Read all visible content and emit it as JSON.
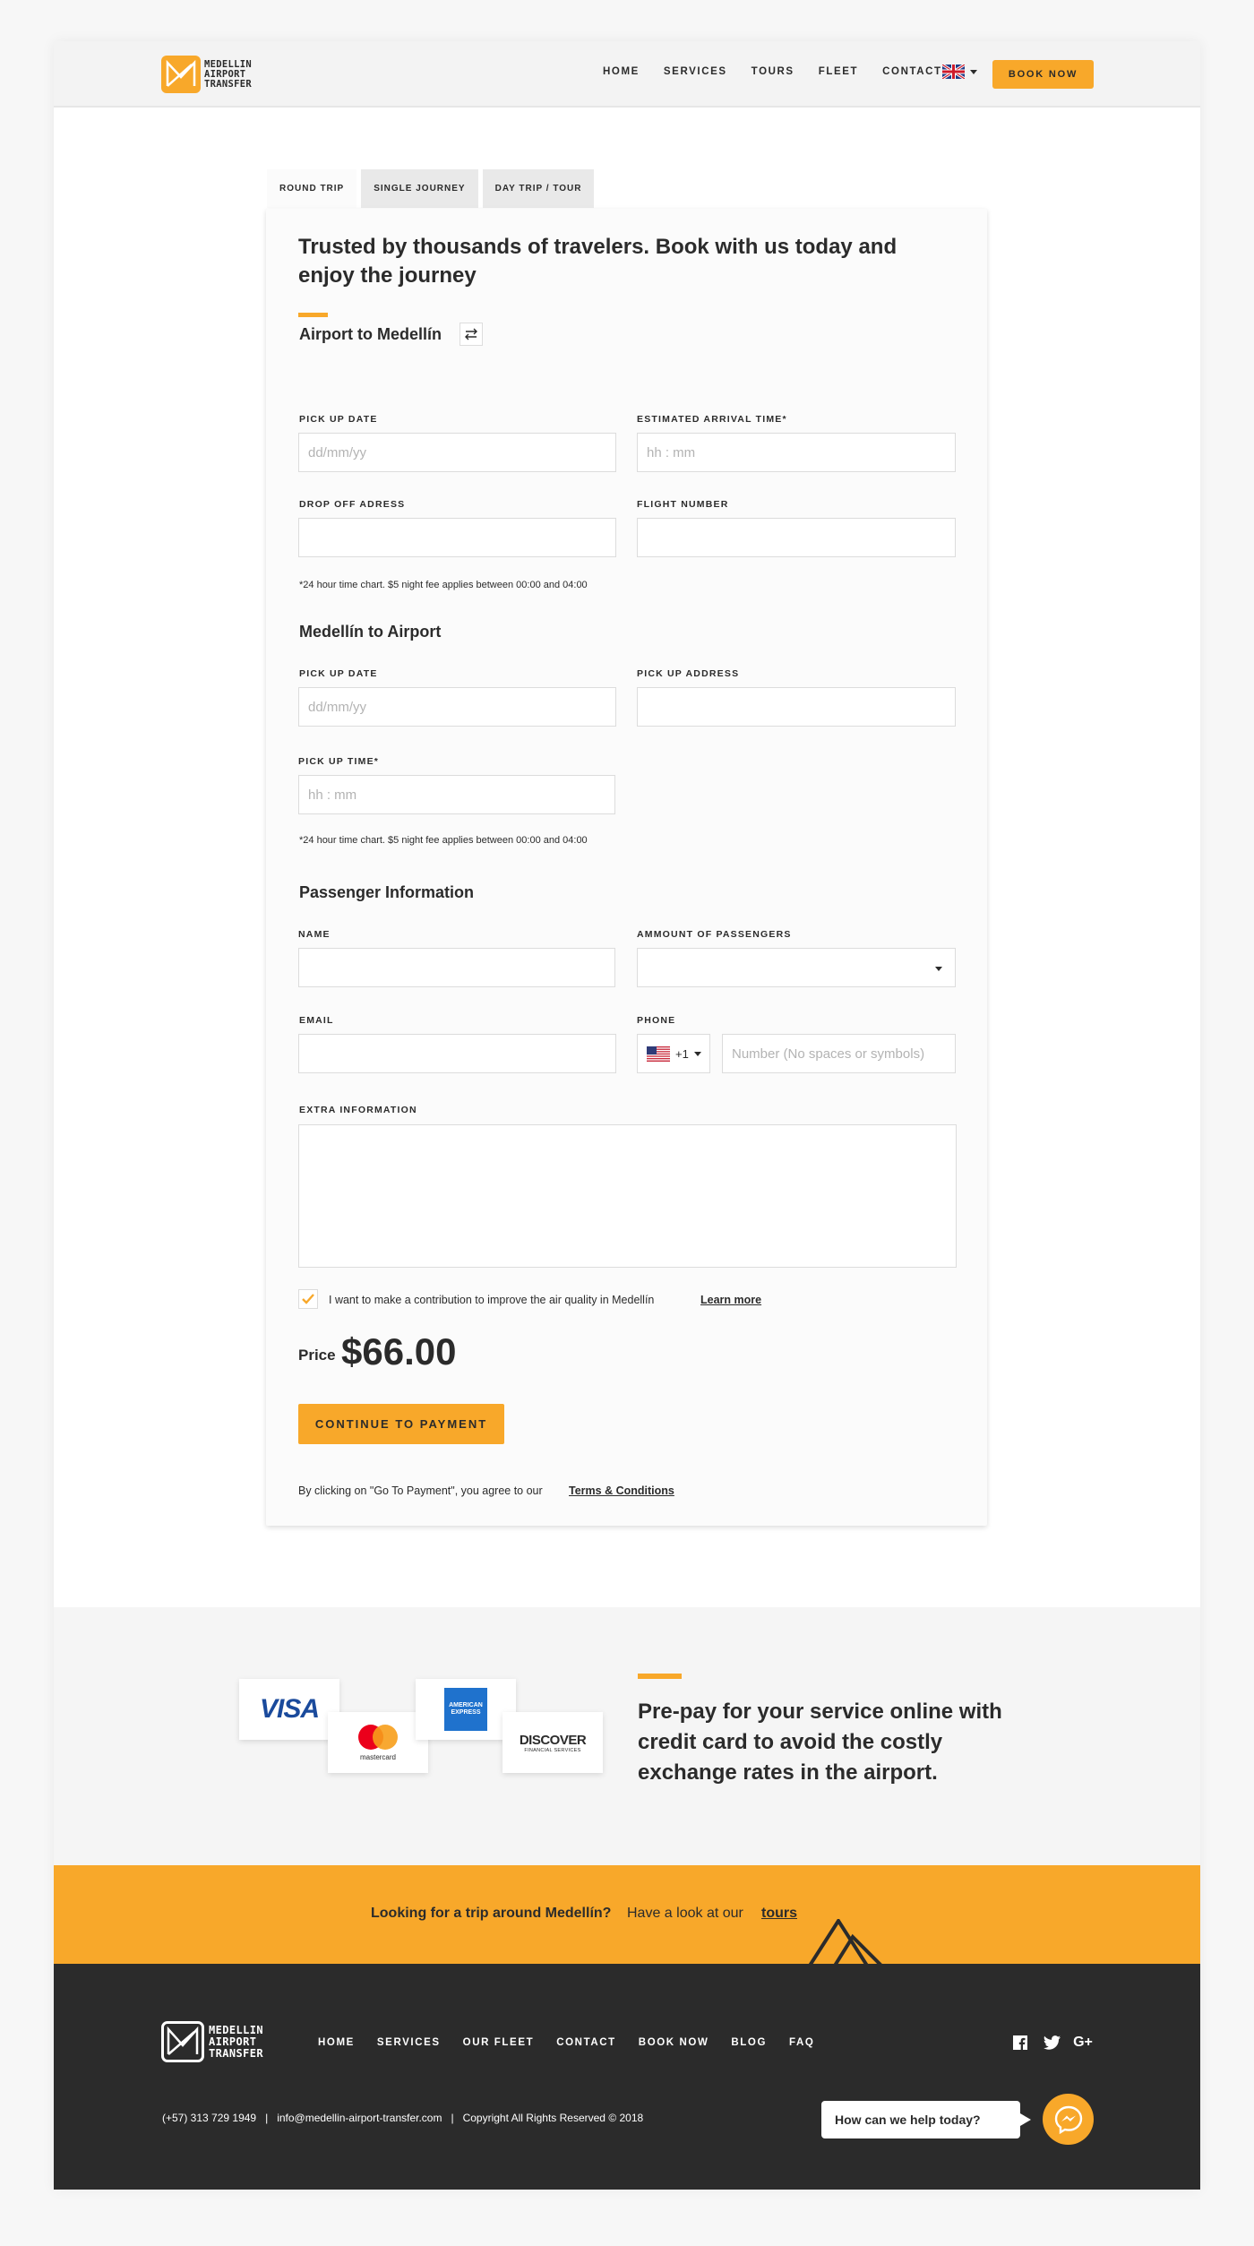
{
  "header": {
    "logo_text": [
      "MEDELLIN",
      "AIRPORT",
      "TRANSFER"
    ],
    "nav": [
      "HOME",
      "SERVICES",
      "TOURS",
      "FLEET",
      "CONTACT"
    ],
    "language_flag": "uk-flag-icon",
    "book_now": "BOOK NOW"
  },
  "tabs": [
    "ROUND TRIP",
    "SINGLE JOURNEY",
    "DAY TRIP / TOUR"
  ],
  "form": {
    "title": "Trusted by thousands of travelers. Book with us today and enjoy the journey",
    "airport_to_medellin": {
      "title": "Airport to Medellín",
      "pickup_date_label": "PICK UP DATE",
      "pickup_date_placeholder": "dd/mm/yy",
      "arrival_time_label": "ESTIMATED ARRIVAL TIME*",
      "arrival_time_placeholder": "hh : mm",
      "dropoff_label": "DROP OFF ADRESS",
      "flight_label": "FLIGHT NUMBER",
      "note": "*24 hour time chart. $5 night fee applies between 00:00 and 04:00"
    },
    "medellin_to_airport": {
      "title": "Medellín to Airport",
      "pickup_date_label": "PICK UP DATE",
      "pickup_date_placeholder": "dd/mm/yy",
      "pickup_address_label": "PICK UP ADDRESS",
      "pickup_time_label": "PICK UP TIME*",
      "pickup_time_placeholder": "hh : mm",
      "note": "*24 hour time chart. $5 night fee applies between 00:00 and 04:00"
    },
    "passenger": {
      "title": "Passenger Information",
      "name_label": "NAME",
      "amount_label": "AMMOUNT OF PASSENGERS",
      "email_label": "EMAIL",
      "phone_label": "PHONE",
      "phone_code": "+1",
      "phone_placeholder": "Number (No spaces or symbols)",
      "extra_label": "EXTRA INFORMATION"
    },
    "contribution_text": "I want to make a contribution to improve the air quality in Medellín",
    "contribution_link": "Learn more",
    "contribution_checked": true,
    "price_label": "Price",
    "price_value": "$66.00",
    "continue_button": "CONTINUE TO PAYMENT",
    "terms_text": "By clicking on \"Go To Payment\", you agree to our",
    "terms_link": "Terms & Conditions"
  },
  "payment": {
    "cards": [
      "VISA",
      "mastercard",
      "AMERICAN EXPRESS",
      "DISCOVER"
    ],
    "discover_sub": "FINANCIAL SERVICES",
    "text": "Pre-pay for your service online with credit card to avoid the costly exchange rates in the airport."
  },
  "tours_banner": {
    "question": "Looking for a trip around Medellín?",
    "text": "Have a look at our",
    "link": "tours"
  },
  "footer": {
    "logo_text": [
      "MEDELLIN",
      "AIRPORT",
      "TRANSFER"
    ],
    "nav": [
      "HOME",
      "SERVICES",
      "OUR FLEET",
      "CONTACT",
      "BOOK NOW",
      "BLOG",
      "FAQ"
    ],
    "info": "(+57) 313 729 1949   |   info@medellin-airport-transfer.com   |   Copyright All Rights Reserved © 2018",
    "chat_text": "How can we help today?",
    "social_icons": [
      "facebook-icon",
      "twitter-icon",
      "google-plus-icon"
    ]
  },
  "colors": {
    "accent": "#f8a82a",
    "dark": "#2b2b2b"
  }
}
